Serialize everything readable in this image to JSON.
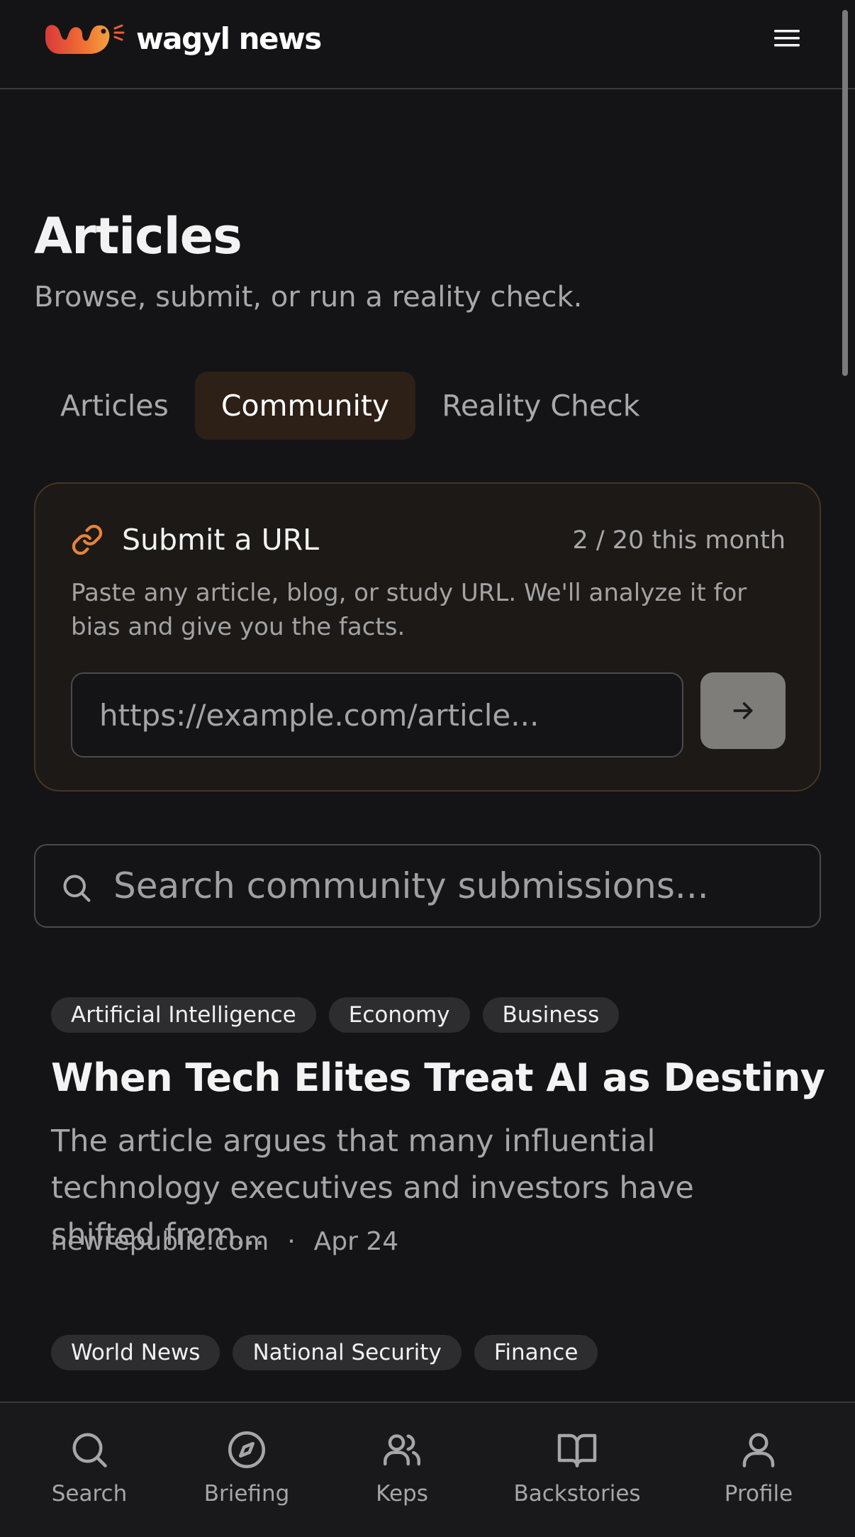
{
  "header": {
    "brand": "wagyl news",
    "menu_icon": "hamburger-menu-icon",
    "brand_colors": [
      "#e8413a",
      "#f28a33",
      "#f5c24c"
    ]
  },
  "main": {
    "title": "Articles",
    "subtitle": "Browse, submit, or run a reality check.",
    "tabs": [
      {
        "label": "Articles",
        "active": false
      },
      {
        "label": "Community",
        "active": true
      },
      {
        "label": "Reality Check",
        "active": false
      }
    ]
  },
  "submit": {
    "icon": "link-icon",
    "title": "Submit a URL",
    "quota": "2 / 20 this month",
    "description": "Paste any article, blog, or study URL. We'll analyze it for bias and give you the facts.",
    "url_placeholder": "https://example.com/article...",
    "url_value": "",
    "submit_icon": "arrow-right-icon",
    "accent_color": "#e8833a"
  },
  "search": {
    "icon": "search-icon",
    "placeholder": "Search community submissions...",
    "value": ""
  },
  "articles": [
    {
      "tags": [
        "Artificial Intelligence",
        "Economy",
        "Business"
      ],
      "title": "When Tech Elites Treat AI as Destiny",
      "summary": "The article argues that many influential technology executives and investors have shifted from...",
      "source": "newrepublic.com",
      "separator": "·",
      "date": "Apr 24"
    },
    {
      "tags": [
        "World News",
        "National Security",
        "Finance"
      ]
    }
  ],
  "bottom_nav": [
    {
      "label": "Search",
      "icon": "search-icon"
    },
    {
      "label": "Briefing",
      "icon": "compass-icon"
    },
    {
      "label": "Keps",
      "icon": "users-icon"
    },
    {
      "label": "Backstories",
      "icon": "book-open-icon"
    },
    {
      "label": "Profile",
      "icon": "user-icon"
    }
  ]
}
